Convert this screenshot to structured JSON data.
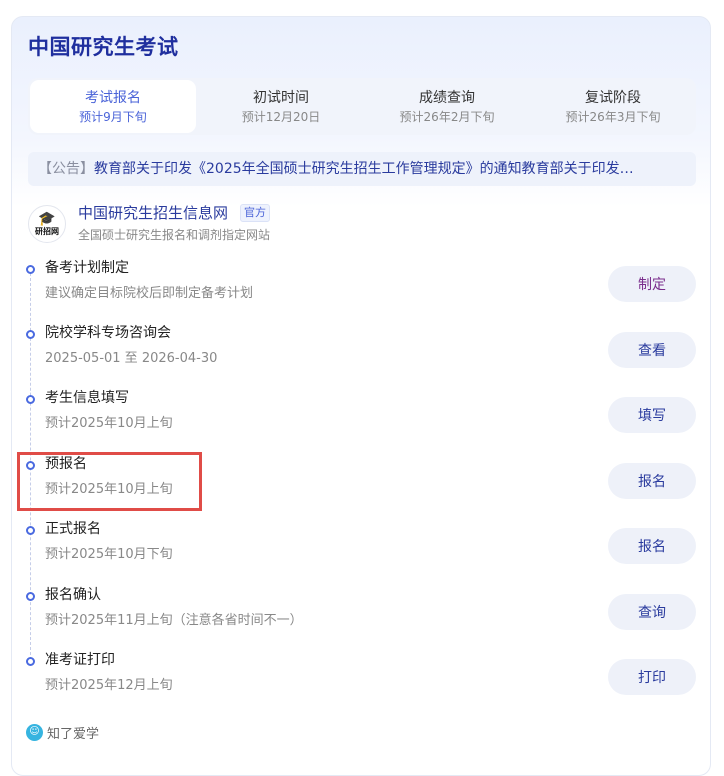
{
  "header": {
    "title": "中国研究生考试"
  },
  "tabs": [
    {
      "name": "考试报名",
      "sub": "预计9月下旬",
      "active": true
    },
    {
      "name": "初试时间",
      "sub": "预计12月20日",
      "active": false
    },
    {
      "name": "成绩查询",
      "sub": "预计26年2月下旬",
      "active": false
    },
    {
      "name": "复试阶段",
      "sub": "预计26年3月下旬",
      "active": false
    }
  ],
  "notice": {
    "tag": "【公告】",
    "text": "教育部关于印发《2025年全国硕士研究生招生工作管理规定》的通知教育部关于印发…"
  },
  "source": {
    "logo_text": "研招网",
    "logo_icon": "graduation-cap-icon",
    "name": "中国研究生招生信息网",
    "badge": "官方",
    "desc": "全国硕士研究生报名和调剂指定网站"
  },
  "steps": [
    {
      "name": "备考计划制定",
      "desc": "建议确定目标院校后即制定备考计划",
      "button": "制定"
    },
    {
      "name": "院校学科专场咨询会",
      "desc": "2025-05-01 至 2026-04-30",
      "button": "查看"
    },
    {
      "name": "考生信息填写",
      "desc": "预计2025年10月上旬",
      "button": "填写"
    },
    {
      "name": "预报名",
      "desc": "预计2025年10月上旬",
      "button": "报名"
    },
    {
      "name": "正式报名",
      "desc": "预计2025年10月下旬",
      "button": "报名"
    },
    {
      "name": "报名确认",
      "desc": "预计2025年11月上旬（注意各省时间不一）",
      "button": "查询"
    },
    {
      "name": "准考证打印",
      "desc": "预计2025年12月上旬",
      "button": "打印"
    }
  ],
  "footer": {
    "text": "知了爱学",
    "icon": "zhiliao-logo-icon"
  },
  "colors": {
    "title": "#1f2f9e",
    "accent": "#4a63d8",
    "highlight_box": "#e04c47",
    "button_bg": "#eef1f9"
  }
}
